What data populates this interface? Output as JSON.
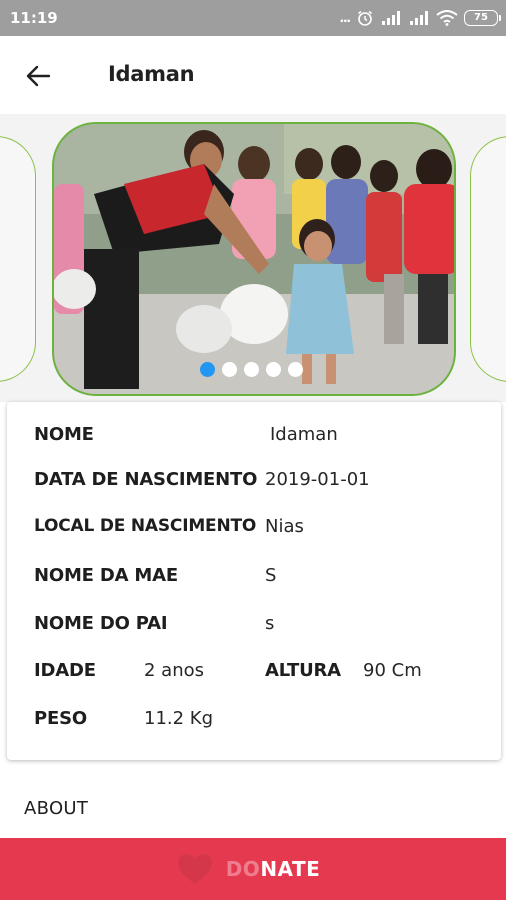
{
  "status_bar": {
    "time": "11:19",
    "dots": "...",
    "battery": "75",
    "icons": [
      "alarm-icon",
      "signal-icon",
      "signal-icon",
      "wifi-icon",
      "battery-icon"
    ]
  },
  "app_bar": {
    "title": "Idaman",
    "back_icon": "arrow-back-icon"
  },
  "carousel": {
    "image_count": 5,
    "active_index": 0,
    "accent": "#6cb33e",
    "active_dot_color": "#2196f3"
  },
  "profile": {
    "name_label": "NOME",
    "name_value": "Idaman",
    "birth_date_label": "DATA DE NASCIMENTO",
    "birth_date_value": "2019-01-01",
    "birth_place_label": "LOCAL DE NASCIMENTO",
    "birth_place_value": "Nias",
    "mother_label": "NOME DA MAE",
    "mother_value": "S",
    "father_label": "NOME DO PAI",
    "father_value": "s",
    "age_label": "IDADE",
    "age_value": "2 anos",
    "height_label": "ALTURA",
    "height_value": "90 Cm",
    "weight_label": "PESO",
    "weight_value": "11.2 Kg"
  },
  "about": {
    "label": "ABOUT"
  },
  "donate": {
    "label_faded": "DO",
    "label_main": "NATE",
    "icon": "heart-icon",
    "color": "#e53950"
  }
}
